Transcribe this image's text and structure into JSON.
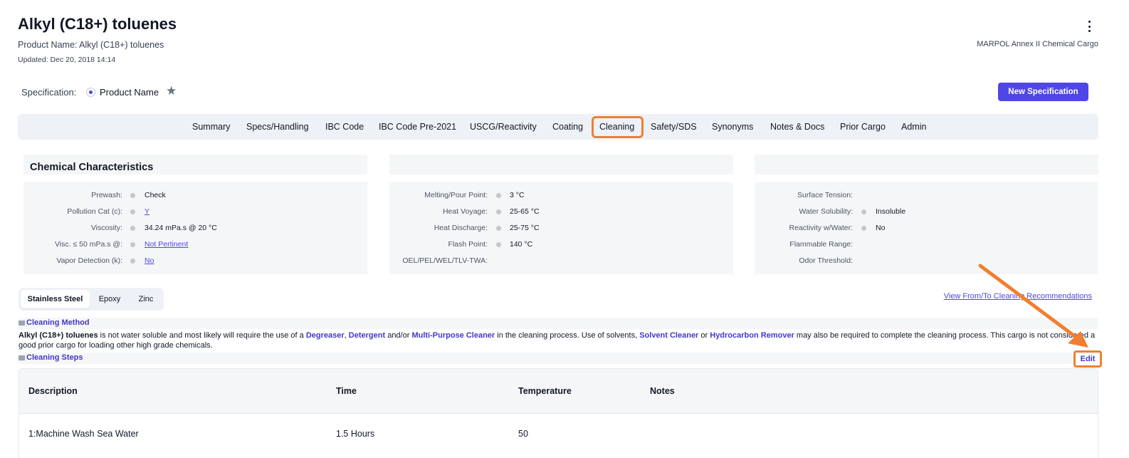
{
  "header": {
    "title": "Alkyl (C18+) toluenes",
    "product_name": "Product Name: Alkyl (C18+) toluenes",
    "updated": "Updated: Dec 20, 2018 14:14",
    "category": "MARPOL Annex II Chemical Cargo",
    "menu_icon": "more-vertical-icon"
  },
  "specification": {
    "label": "Specification:",
    "selected": "Product Name",
    "favorite_icon": "star-icon",
    "new_button": "New Specification"
  },
  "tabs": [
    "Summary",
    "Specs/Handling",
    "IBC Code",
    "IBC Code Pre-2021",
    "USCG/Reactivity",
    "Coating",
    "Cleaning",
    "Safety/SDS",
    "Synonyms",
    "Notes & Docs",
    "Prior Cargo",
    "Admin"
  ],
  "active_tab": "Cleaning",
  "characteristics": {
    "title": "Chemical Characteristics",
    "col1": [
      {
        "label": "Prewash:",
        "value": "Check",
        "link": false
      },
      {
        "label": "Pollution Cat (c):",
        "value": "Y",
        "link": true
      },
      {
        "label": "Viscosity:",
        "value": "34.24 mPa.s @ 20 °C",
        "link": false
      },
      {
        "label": "Visc. ≤ 50 mPa.s @:",
        "value": "Not Pertinent",
        "link": true
      },
      {
        "label": "Vapor Detection (k):",
        "value": "No",
        "link": true
      }
    ],
    "col2": [
      {
        "label": "Melting/Pour Point:",
        "value": "3 °C"
      },
      {
        "label": "Heat Voyage:",
        "value": "25-65 °C"
      },
      {
        "label": "Heat Discharge:",
        "value": "25-75 °C"
      },
      {
        "label": "Flash Point:",
        "value": "140 °C"
      },
      {
        "label": "OEL/PEL/WEL/TLV-TWA:",
        "value": ""
      }
    ],
    "col3": [
      {
        "label": "Surface Tension:",
        "value": ""
      },
      {
        "label": "Water Solubility:",
        "value": "Insoluble"
      },
      {
        "label": "Reactivity w/Water:",
        "value": "No"
      },
      {
        "label": "Flammable Range:",
        "value": ""
      },
      {
        "label": "Odor Threshold:",
        "value": ""
      }
    ]
  },
  "materials": [
    "Stainless Steel",
    "Epoxy",
    "Zinc"
  ],
  "active_material": "Stainless Steel",
  "recommendations_link": "View From/To Cleaning Recommendations",
  "cleaning_method": {
    "title": "Cleaning Method",
    "product": "Alkyl (C18+) toluenes",
    "t1": " is not water soluble and most likely will require the use of a ",
    "k1": "Degreaser",
    "t2": ", ",
    "k2": "Detergent",
    "t3": " and/or ",
    "k3": "Multi-Purpose Cleaner",
    "t4": " in the cleaning process. Use of solvents, ",
    "k4": "Solvent Cleaner",
    "t5": " or ",
    "k5": "Hydrocarbon Remover",
    "t6": " may also be required to complete the cleaning process. This cargo is not considered a good prior cargo for loading other high grade chemicals."
  },
  "cleaning_steps": {
    "title": "Cleaning Steps",
    "edit": "Edit",
    "columns": [
      "Description",
      "Time",
      "Temperature",
      "Notes"
    ],
    "rows": [
      {
        "description": "1:Machine Wash Sea Water",
        "time": "1.5 Hours",
        "temperature": "50",
        "notes": ""
      }
    ]
  },
  "colors": {
    "accent": "#4f46e5",
    "highlight": "#f07f31"
  }
}
